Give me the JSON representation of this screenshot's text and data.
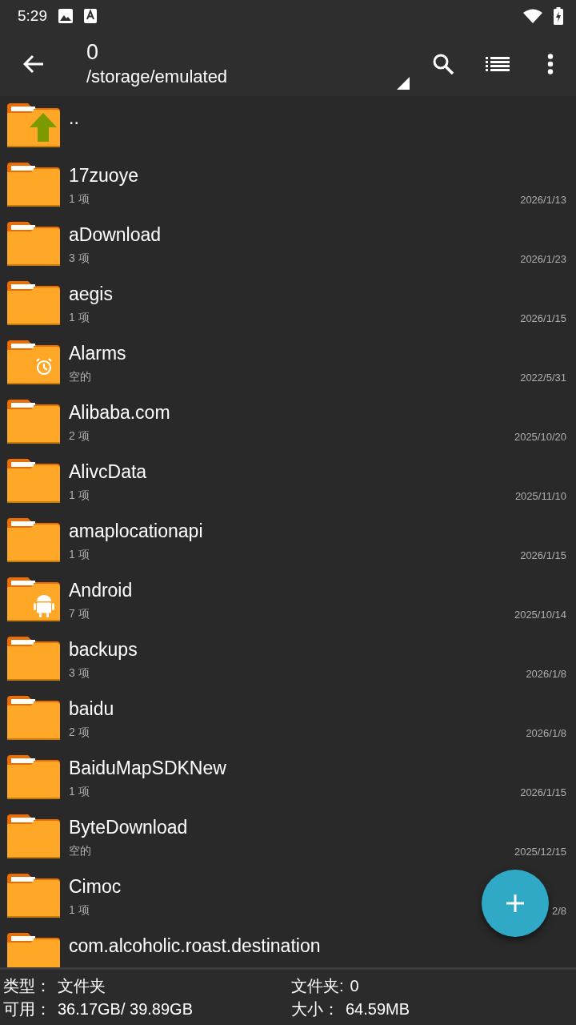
{
  "status_bar": {
    "time": "5:29"
  },
  "toolbar": {
    "title": "0",
    "path": "/storage/emulated"
  },
  "files": [
    {
      "name": "..",
      "kind": "up"
    },
    {
      "name": "17zuoye",
      "info": "1 项",
      "date": "2026/1/13",
      "kind": "plain"
    },
    {
      "name": "aDownload",
      "info": "3 项",
      "date": "2026/1/23",
      "kind": "plain"
    },
    {
      "name": "aegis",
      "info": "1 项",
      "date": "2026/1/15",
      "kind": "plain"
    },
    {
      "name": "Alarms",
      "info": "空的",
      "date": "2022/5/31",
      "kind": "alarm"
    },
    {
      "name": "Alibaba.com",
      "info": "2 项",
      "date": "2025/10/20",
      "kind": "plain"
    },
    {
      "name": "AlivcData",
      "info": "1 项",
      "date": "2025/11/10",
      "kind": "plain"
    },
    {
      "name": "amaplocationapi",
      "info": "1 项",
      "date": "2026/1/15",
      "kind": "plain"
    },
    {
      "name": "Android",
      "info": "7 项",
      "date": "2025/10/14",
      "kind": "android"
    },
    {
      "name": "backups",
      "info": "3 项",
      "date": "2026/1/8",
      "kind": "plain"
    },
    {
      "name": "baidu",
      "info": "2 项",
      "date": "2026/1/8",
      "kind": "plain"
    },
    {
      "name": "BaiduMapSDKNew",
      "info": "1 项",
      "date": "2026/1/15",
      "kind": "plain"
    },
    {
      "name": "ByteDownload",
      "info": "空的",
      "date": "2025/12/15",
      "kind": "plain"
    },
    {
      "name": "Cimoc",
      "info": "1 项",
      "date": "2/8",
      "kind": "plain"
    },
    {
      "name": "com.alcoholic.roast.destination",
      "kind": "plain"
    }
  ],
  "details": [
    {
      "label": "类型：",
      "value": "文件夹"
    },
    {
      "label": "文件夹:",
      "value": "0"
    },
    {
      "label": "可用：",
      "value": "36.17GB/ 39.89GB"
    },
    {
      "label": "大小：",
      "value": "64.59MB"
    }
  ]
}
